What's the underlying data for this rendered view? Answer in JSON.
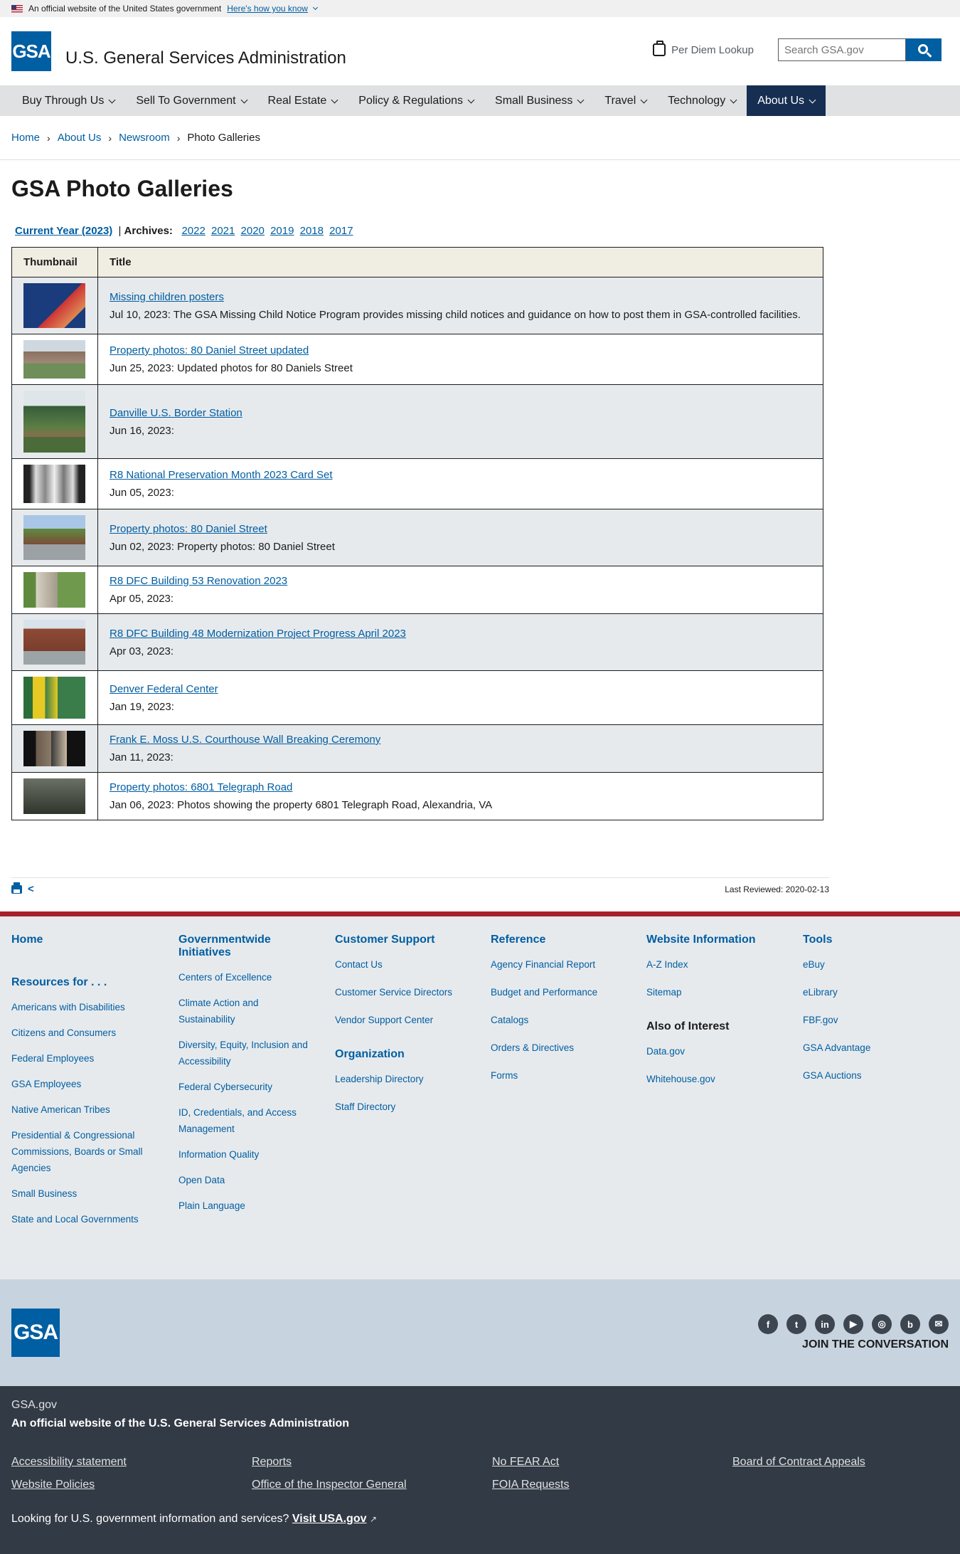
{
  "banner": {
    "text": "An official website of the United States government",
    "link": "Here's how you know"
  },
  "header": {
    "logo": "GSA",
    "title": "U.S. General Services Administration",
    "per_diem": "Per Diem Lookup",
    "search_placeholder": "Search GSA.gov"
  },
  "nav": [
    "Buy Through Us",
    "Sell To Government",
    "Real Estate",
    "Policy & Regulations",
    "Small Business",
    "Travel",
    "Technology",
    "About Us"
  ],
  "breadcrumb": [
    "Home",
    "About Us",
    "Newsroom",
    "Photo Galleries"
  ],
  "page": {
    "title": "GSA Photo Galleries",
    "current_year": "Current Year (2023)",
    "separator": "|",
    "archives_label": "Archives:",
    "archives": [
      "2022",
      "2021",
      "2020",
      "2019",
      "2018",
      "2017"
    ]
  },
  "table": {
    "headers": [
      "Thumbnail",
      "Title"
    ],
    "rows": [
      {
        "title": "Missing children posters",
        "desc": "Jul 10, 2023: The GSA Missing Child Notice Program provides missing child notices and guidance on how to post them in GSA-controlled facilities."
      },
      {
        "title": "Property photos: 80 Daniel Street updated",
        "desc": "Jun 25, 2023: Updated photos for 80 Daniels Street"
      },
      {
        "title": "Danville U.S. Border Station",
        "desc": "Jun 16, 2023:"
      },
      {
        "title": "R8 National Preservation Month 2023 Card Set",
        "desc": "Jun 05, 2023:"
      },
      {
        "title": "Property photos: 80 Daniel Street",
        "desc": "Jun 02, 2023: Property photos: 80 Daniel Street"
      },
      {
        "title": "R8 DFC Building 53 Renovation 2023",
        "desc": "Apr 05, 2023:"
      },
      {
        "title": "R8 DFC Building 48 Modernization Project Progress April 2023",
        "desc": "Apr 03, 2023:"
      },
      {
        "title": "Denver Federal Center",
        "desc": "Jan 19, 2023:"
      },
      {
        "title": "Frank E. Moss U.S. Courthouse Wall Breaking Ceremony",
        "desc": "Jan 11, 2023:"
      },
      {
        "title": "Property photos: 6801 Telegraph Road",
        "desc": "Jan 06, 2023: Photos showing the property 6801 Telegraph Road, Alexandria, VA"
      }
    ]
  },
  "last_reviewed": "Last Reviewed: 2020-02-13",
  "footer": {
    "home": "Home",
    "resources_heading": "Resources for . . .",
    "resources": [
      "Americans with Disabilities",
      "Citizens and Consumers",
      "Federal Employees",
      "GSA Employees",
      "Native American Tribes",
      "Presidential & Congressional Commissions, Boards or Small Agencies",
      "Small Business",
      "State and Local Governments"
    ],
    "govwide_heading": "Governmentwide Initiatives",
    "govwide": [
      "Centers of Excellence",
      "Climate Action and Sustainability",
      "Diversity, Equity, Inclusion and Accessibility",
      "Federal Cybersecurity",
      "ID, Credentials, and Access Management",
      "Information Quality",
      "Open Data",
      "Plain Language"
    ],
    "support_heading": "Customer Support",
    "support": [
      "Contact Us",
      "Customer Service Directors",
      "Vendor Support Center"
    ],
    "org_heading": "Organization",
    "org": [
      "Leadership Directory",
      "Staff Directory"
    ],
    "reference_heading": "Reference",
    "reference": [
      "Agency Financial Report",
      "Budget and Performance",
      "Catalogs",
      "Orders & Directives",
      "Forms"
    ],
    "webinfo_heading": "Website Information",
    "webinfo": [
      "A-Z Index",
      "Sitemap"
    ],
    "interest_heading": "Also of Interest",
    "interest": [
      "Data.gov",
      "Whitehouse.gov"
    ],
    "tools_heading": "Tools",
    "tools": [
      "eBuy",
      "eLibrary",
      "FBF.gov",
      "GSA Advantage",
      "GSA Auctions"
    ]
  },
  "brand": {
    "logo": "GSA",
    "join": "JOIN THE CONVERSATION",
    "social": [
      "facebook-icon",
      "twitter-icon",
      "linkedin-icon",
      "youtube-icon",
      "instagram-icon",
      "blog-icon",
      "email-icon"
    ]
  },
  "identifier": {
    "domain": "GSA.gov",
    "official": "An official website of the U.S. General Services Administration",
    "links": [
      "Accessibility statement",
      "Reports",
      "No FEAR Act",
      "Board of Contract Appeals",
      "Website Policies",
      "Office of the Inspector General",
      "FOIA Requests"
    ],
    "usa_text": "Looking for U.S. government information and services?",
    "usa_link": "Visit USA.gov"
  }
}
